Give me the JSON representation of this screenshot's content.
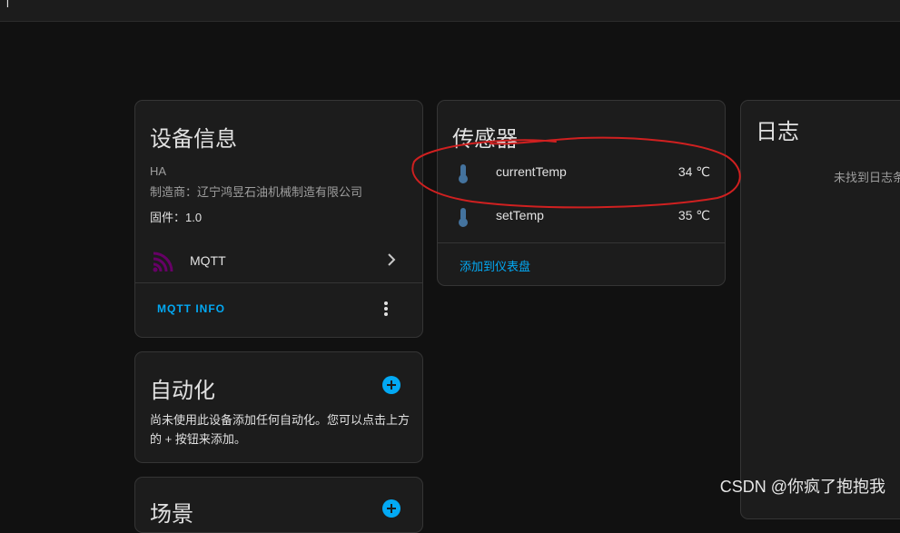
{
  "topbar": {
    "title_fragment": "' |"
  },
  "device_info": {
    "title": "设备信息",
    "model": "HA",
    "manufacturer_line": "制造商：辽宁鸿昱石油机械制造有限公司",
    "firmware_line": "固件：1.0",
    "integration_label": "MQTT",
    "action_label": "MQTT INFO"
  },
  "sensors": {
    "title": "传感器",
    "items": [
      {
        "name": "currentTemp",
        "value": "34 ℃"
      },
      {
        "name": "setTemp",
        "value": "35 ℃"
      }
    ],
    "add_label": "添加到仪表盘"
  },
  "logbook": {
    "title": "日志",
    "empty_text": "未找到日志条"
  },
  "automations": {
    "title": "自动化",
    "description": "尚未使用此设备添加任何自动化。您可以点击上方的 + 按钮来添加。"
  },
  "scenes": {
    "title_fragment": "场景"
  },
  "watermark": "CSDN @你疯了抱抱我",
  "colors": {
    "accent": "#03a9f4",
    "mqtt_icon": "#660066",
    "thermometer": "#44739e",
    "annotation": "#d02020"
  },
  "icons": {
    "mqtt": "mqtt-icon",
    "thermometer": "thermometer-icon",
    "chevron": "chevron-right-icon",
    "kebab": "more-vertical-icon",
    "add": "add-circle-icon"
  }
}
